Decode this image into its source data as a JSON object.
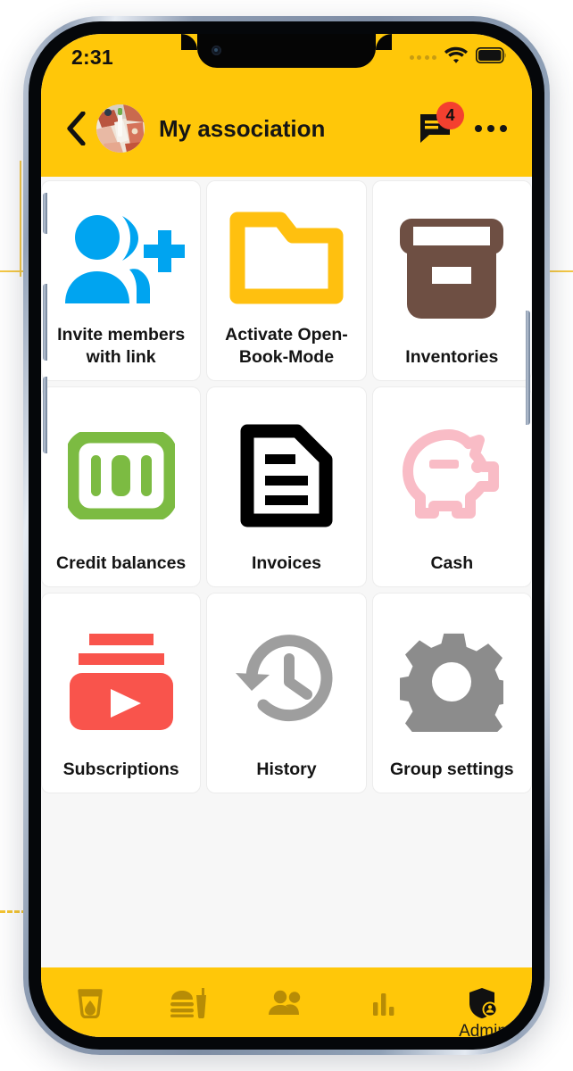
{
  "status_bar": {
    "time": "2:31",
    "signal_icon": "signal-dots-icon",
    "wifi_icon": "wifi-icon",
    "battery_icon": "battery-full-icon"
  },
  "header": {
    "back_icon": "back-chevron-icon",
    "avatar_icon": "group-avatar-photo",
    "title": "My association",
    "chat_icon": "chat-bubble-icon",
    "chat_badge_count": "4",
    "more_icon": "more-options-icon",
    "background_color": "#ffc709"
  },
  "grid": {
    "tiles": [
      {
        "label": "Invite members with link",
        "icon": "person-add-icon",
        "color": "#00a4f0"
      },
      {
        "label": "Activate Open-Book-Mode",
        "icon": "open-folder-icon",
        "color": "#ffc00f"
      },
      {
        "label": "Inventories",
        "icon": "archive-box-icon",
        "color": "#6e4f43"
      },
      {
        "label": "Credit balances",
        "icon": "hundred-banknote-icon",
        "color": "#7cbb42"
      },
      {
        "label": "Invoices",
        "icon": "document-lines-icon",
        "color": "#000000"
      },
      {
        "label": "Cash",
        "icon": "piggy-bank-icon",
        "color": "#f9bcc6"
      },
      {
        "label": "Subscriptions",
        "icon": "subscriptions-play-icon",
        "color": "#f9544c"
      },
      {
        "label": "History",
        "icon": "history-clock-icon",
        "color": "#9e9e9e"
      },
      {
        "label": "Group settings",
        "icon": "gear-icon",
        "color": "#8c8c8c"
      }
    ]
  },
  "bottom_nav": {
    "items": [
      {
        "label": "",
        "icon": "drink-glass-icon",
        "active": false
      },
      {
        "label": "",
        "icon": "food-burger-drink-icon",
        "active": false
      },
      {
        "label": "",
        "icon": "people-group-icon",
        "active": false
      },
      {
        "label": "",
        "icon": "bar-chart-icon",
        "active": false
      },
      {
        "label": "Admin",
        "icon": "admin-shield-icon",
        "active": true
      }
    ],
    "background_color": "#ffc709",
    "inactive_icon_color": "#b78c06",
    "active_icon_color": "#111111"
  }
}
